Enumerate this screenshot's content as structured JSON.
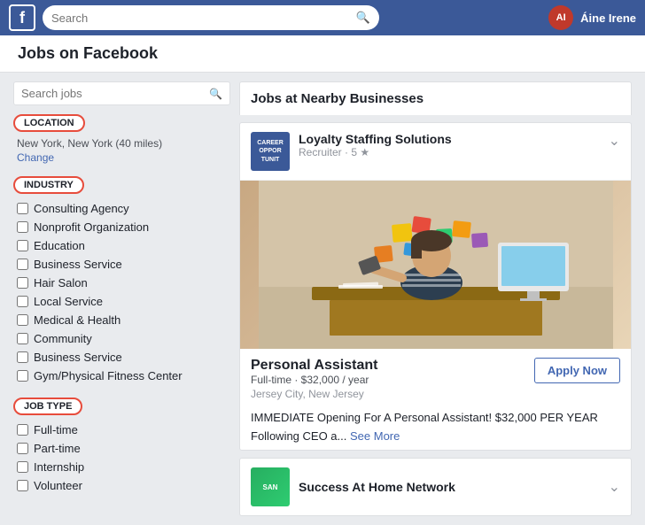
{
  "nav": {
    "logo_letter": "f",
    "search_placeholder": "Search",
    "user_name": "Áine Irene",
    "user_initials": "AI"
  },
  "page": {
    "title": "Jobs on Facebook"
  },
  "sidebar": {
    "search_placeholder": "Search jobs",
    "location_label": "LOCATION",
    "location_text": "New York, New York (40 miles)",
    "location_change": "Change",
    "industry_label": "INDUSTRY",
    "industry_items": [
      "Consulting Agency",
      "Nonprofit Organization",
      "Education",
      "Business Service",
      "Hair Salon",
      "Local Service",
      "Medical & Health",
      "Community",
      "Business Service",
      "Gym/Physical Fitness Center"
    ],
    "job_type_label": "JOB TYPE",
    "job_type_items": [
      "Full-time",
      "Part-time",
      "Internship",
      "Volunteer"
    ]
  },
  "main": {
    "section_title": "Jobs at Nearby Businesses",
    "job1": {
      "company_name": "Loyalty Staffing Solutions",
      "company_meta": "Recruiter · 5 ★",
      "logo_text": "CAREER\nOPPOR-\nTUNITIES",
      "title": "Personal Assistant",
      "type_salary": "Full-time · $32,000 / year",
      "location": "Jersey City, New Jersey",
      "apply_label": "Apply Now",
      "description": "IMMEDIATE Opening For A Personal Assistant!\n$32,000 PER YEAR",
      "description2": "Following CEO a...",
      "see_more": "See More"
    },
    "job2": {
      "company_name": "Success At Home Network",
      "logo_text": "SAN"
    }
  }
}
